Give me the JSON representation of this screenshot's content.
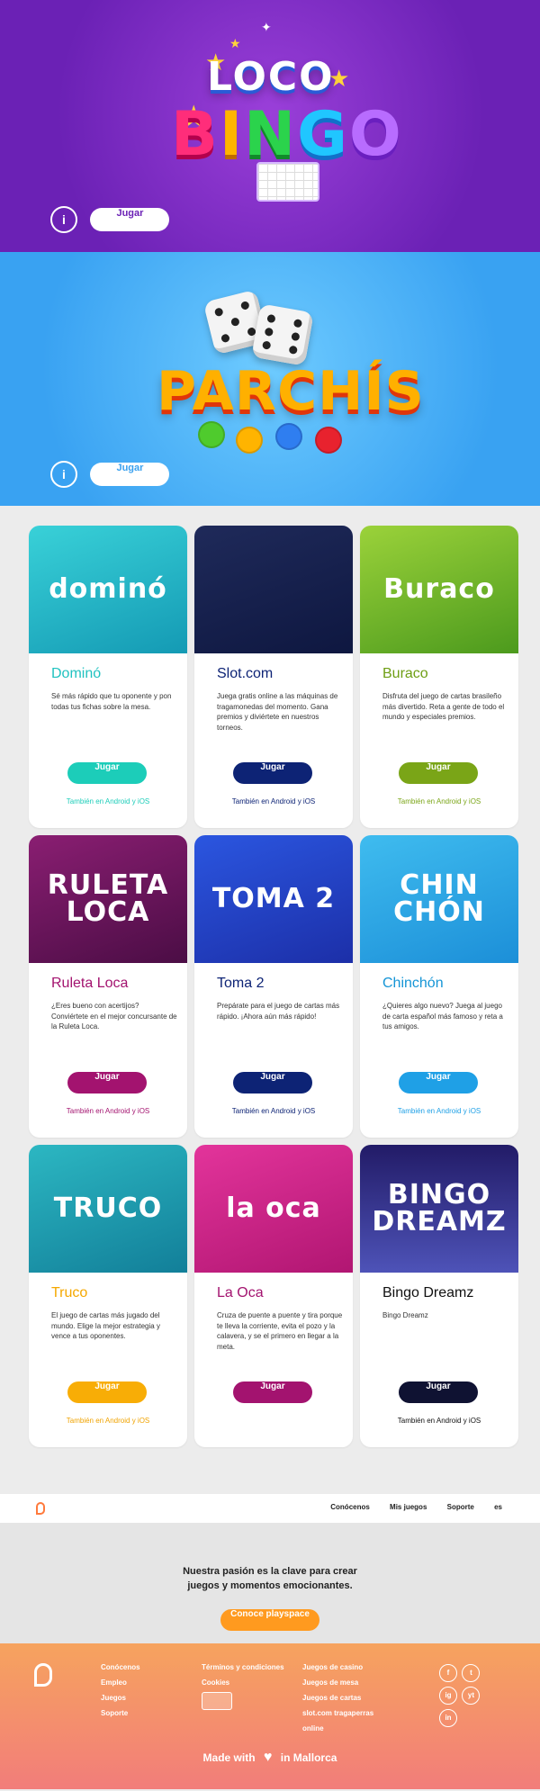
{
  "hero_bingo": {
    "logo_top": "LOCO",
    "logo_bottom": [
      "B",
      "I",
      "N",
      "G",
      "O"
    ],
    "info_label": "i",
    "play_label": "Jugar",
    "play_color": "#6b21b5"
  },
  "hero_parchis": {
    "logo": "PARCHÍS",
    "info_label": "i",
    "play_label": "Jugar",
    "play_color": "#3aa1ef"
  },
  "games": [
    {
      "art": "dominó",
      "art_bg": "linear-gradient(160deg,#39d1d8,#149ab4)",
      "title": "Dominó",
      "title_color": "#20c2c0",
      "desc": "Sé más rápido que tu oponente y pon todas tus fichas sobre la mesa.",
      "play": "Jugar",
      "btn_color": "#1ccdb9",
      "also": "También en Android y iOS",
      "also_color": "#1ccdb9"
    },
    {
      "art": "",
      "art_bg": "linear-gradient(160deg,#1f2a5a,#0e1740)",
      "title": "Slot.com",
      "title_color": "#0d2375",
      "desc": "Juega gratis online a las máquinas de tragamonedas del momento. Gana premios y diviértete en nuestros torneos.",
      "play": "Jugar",
      "btn_color": "#0d2375",
      "also": "También en Android y iOS",
      "also_color": "#0d2375"
    },
    {
      "art": "Buraco",
      "art_bg": "linear-gradient(160deg,#9bd23a,#4c9a1d)",
      "title": "Buraco",
      "title_color": "#6e9e14",
      "desc": "Disfruta del juego de cartas brasileño más divertido. Reta a gente de todo el mundo y especiales premios.",
      "play": "Jugar",
      "btn_color": "#7aa517",
      "also": "También en Android y iOS",
      "also_color": "#7aa517"
    },
    {
      "art": "RULETA LOCA",
      "art_bg": "linear-gradient(160deg,#8a1e72,#4b0d45)",
      "title": "Ruleta Loca",
      "title_color": "#a3136f",
      "desc": "¿Eres bueno con acertijos? Conviértete en el mejor concursante de la Ruleta Loca.",
      "play": "Jugar",
      "btn_color": "#a3136f",
      "also": "También en Android y iOS",
      "also_color": "#a3136f"
    },
    {
      "art": "TOMA 2",
      "art_bg": "linear-gradient(160deg,#2b56e0,#1c2fa8)",
      "title": "Toma 2",
      "title_color": "#0d2375",
      "desc": "Prepárate para el juego de cartas más rápido. ¡Ahora aún más rápido!",
      "play": "Jugar",
      "btn_color": "#0d2375",
      "also": "También en Android y iOS",
      "also_color": "#0d2375"
    },
    {
      "art": "CHIN CHÓN",
      "art_bg": "linear-gradient(160deg,#3fbcef,#1c8fd8)",
      "title": "Chinchón",
      "title_color": "#1595d6",
      "desc": "¿Quieres algo nuevo? Juega al juego de carta español más famoso y reta a tus amigos.",
      "play": "Jugar",
      "btn_color": "#1fa0e6",
      "also": "También en Android y iOS",
      "also_color": "#1fa0e6"
    },
    {
      "art": "TRUCO",
      "art_bg": "linear-gradient(160deg,#2cb7c2,#127f99)",
      "title": "Truco",
      "title_color": "#f5a800",
      "desc": "El juego de cartas más jugado del mundo. Elige la mejor estrategia y vence a tus oponentes.",
      "play": "Jugar",
      "btn_color": "#f8ad06",
      "also": "También en Android y iOS",
      "also_color": "#f0a300"
    },
    {
      "art": "la oca",
      "art_bg": "linear-gradient(160deg,#e3349b,#b11672)",
      "title": "La Oca",
      "title_color": "#a3136f",
      "desc": "Cruza de puente a puente y tira porque te lleva la corriente, evita el pozo y la calavera, y se el primero en llegar a la meta.",
      "play": "Jugar",
      "btn_color": "#a3136f",
      "also": "",
      "also_color": "#a3136f"
    },
    {
      "art": "BINGO DREAMZ",
      "art_bg": "linear-gradient(180deg,#221b67,#4e53b8)",
      "title": "Bingo Dreamz",
      "title_color": "#111111",
      "desc": "Bingo Dreamz",
      "play": "Jugar",
      "btn_color": "#0f1232",
      "also": "También en Android y iOS",
      "also_color": "#111111"
    }
  ],
  "topnav": {
    "links": [
      "Conócenos",
      "Mis juegos",
      "Soporte",
      "es"
    ]
  },
  "passion": {
    "line1": "Nuestra pasión es la clave para crear",
    "line2": "juegos y momentos emocionantes.",
    "cta": "Conoce playspace"
  },
  "footer": {
    "col1": [
      "Conócenos",
      "Empleo",
      "Juegos",
      "Soporte"
    ],
    "col2": [
      "Términos y condiciones",
      "Cookies"
    ],
    "col3": [
      "Juegos de casino",
      "Juegos de mesa",
      "Juegos de cartas",
      "slot.com tragaperras",
      "online"
    ],
    "socials": [
      "f",
      "t",
      "ig",
      "yt",
      "in"
    ],
    "made_left": "Made with",
    "made_right": "in Mallorca"
  }
}
